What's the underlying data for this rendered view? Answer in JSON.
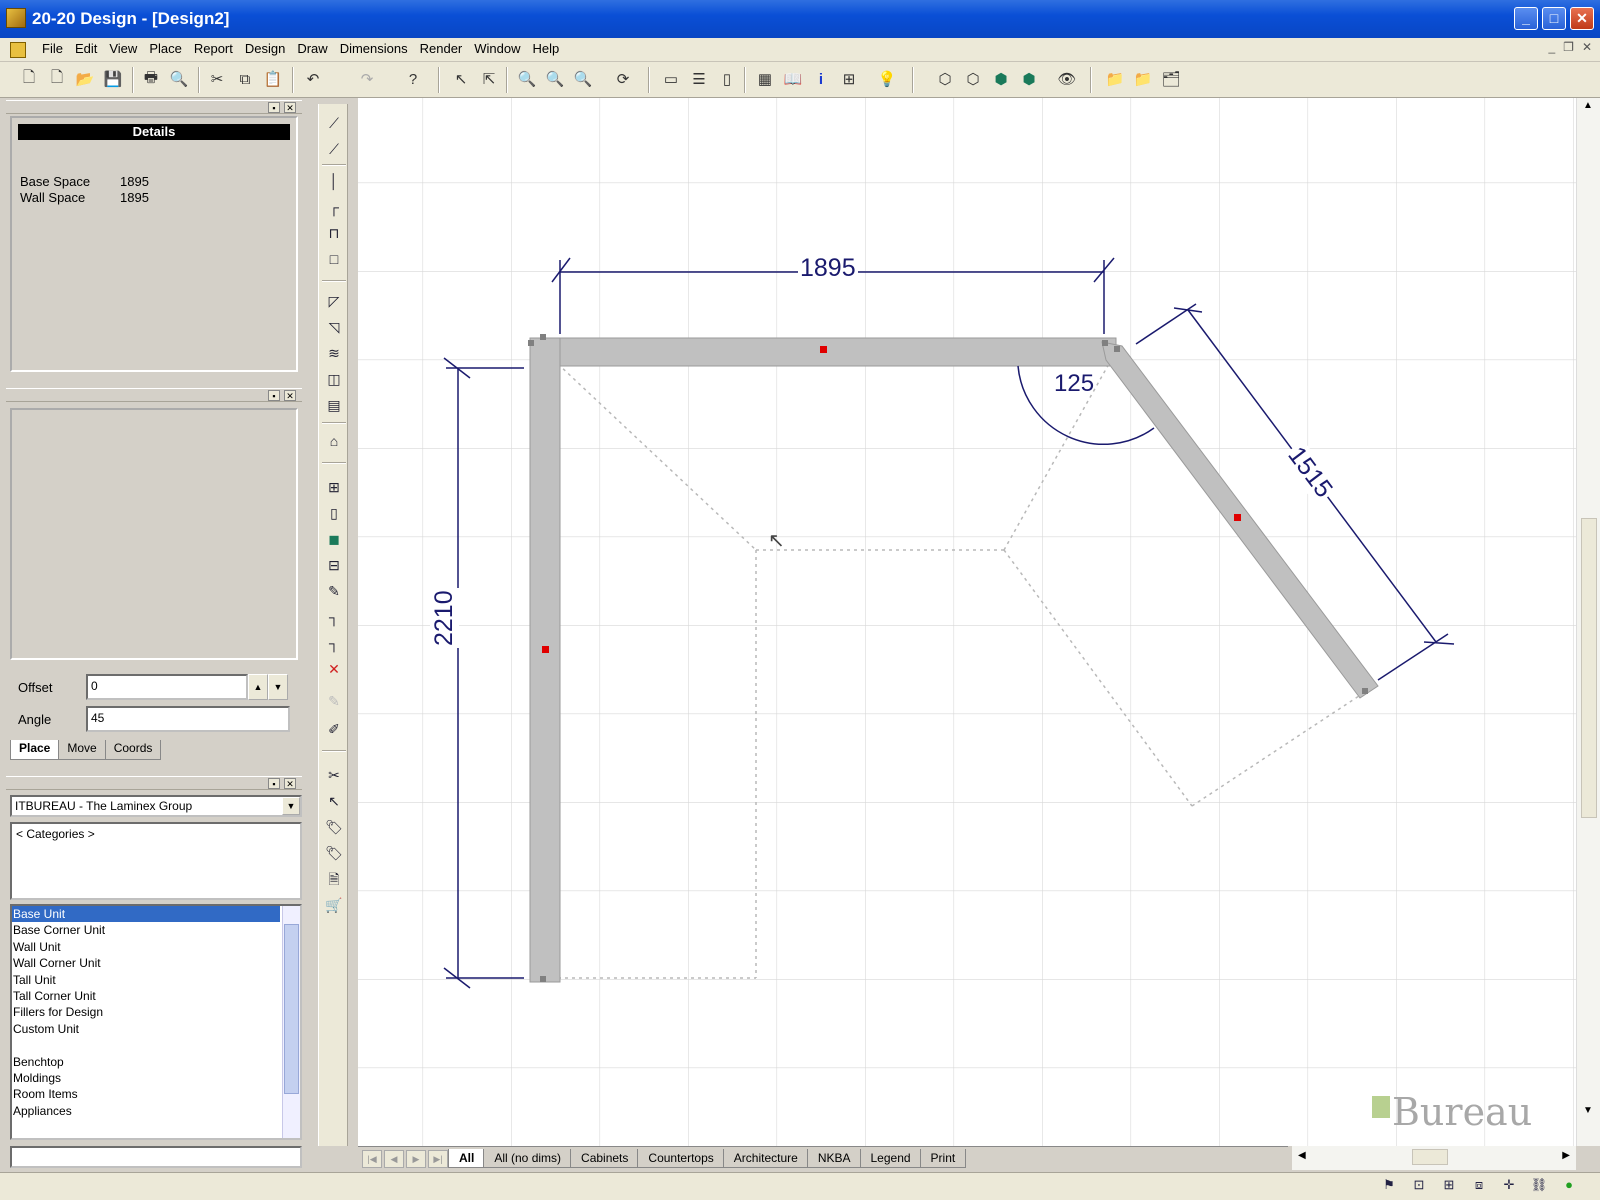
{
  "window": {
    "title": "20-20 Design - [Design2]"
  },
  "menu": [
    "File",
    "Edit",
    "View",
    "Place",
    "Report",
    "Design",
    "Draw",
    "Dimensions",
    "Render",
    "Window",
    "Help"
  ],
  "toolbar_icons": [
    "new-icon",
    "new-doc-icon",
    "open-icon",
    "save-icon",
    "print-icon",
    "print-preview-icon",
    "cut-icon",
    "copy-icon",
    "paste-icon",
    "undo-icon",
    "redo-icon",
    "help-icon",
    "select-icon",
    "select-multi-icon",
    "zoom-icon",
    "zoom-in-icon",
    "zoom-out-icon",
    "refresh-icon",
    "window-icon",
    "list-icon",
    "panel-icon",
    "plan-view-icon",
    "book-icon",
    "info-icon",
    "grid-icon",
    "light-icon",
    "cube-icon",
    "cube2-icon",
    "cube3-icon",
    "cube4-icon",
    "eye-icon",
    "folder-icon",
    "folder2-icon",
    "catalog-icon"
  ],
  "details": {
    "header": "Details",
    "rows": [
      {
        "key": "Base Space",
        "value": "1895"
      },
      {
        "key": "Wall Space",
        "value": "1895"
      }
    ]
  },
  "place": {
    "offset_label": "Offset",
    "offset_value": "0",
    "angle_label": "Angle",
    "angle_value": "45",
    "tabs": [
      "Place",
      "Move",
      "Coords"
    ]
  },
  "catalog": {
    "selected": "ITBUREAU - The Laminex Group",
    "categories_label": "< Categories >",
    "items": [
      "Base Unit",
      "Base Corner Unit",
      "Wall Unit",
      "Wall Corner Unit",
      "Tall Unit",
      "Tall Corner Unit",
      "Fillers for Design",
      "Custom Unit",
      "",
      "Benchtop",
      "Moldings",
      "Room Items",
      "Appliances"
    ]
  },
  "drawing": {
    "dim_top": "1895",
    "dim_left": "2210",
    "dim_right": "1515",
    "angle": "125"
  },
  "view_tabs": [
    "All",
    "All (no dims)",
    "Cabinets",
    "Countertops",
    "Architecture",
    "NKBA",
    "Legend",
    "Print"
  ],
  "watermark": "Bureau",
  "colors": {
    "titlebar": "#0a4fd6",
    "selection": "#316ac5",
    "wall": "#c0c0c0",
    "dimension": "#1a1a6e",
    "handle": "#e00000"
  }
}
